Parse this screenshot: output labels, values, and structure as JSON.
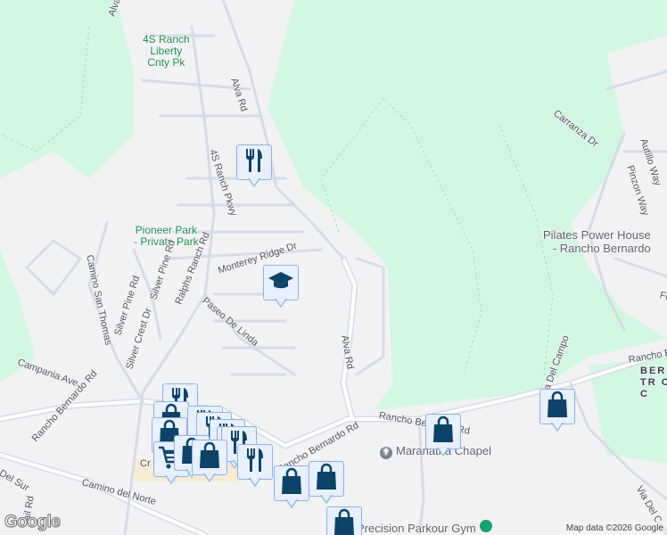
{
  "map": {
    "attribution": "Map data ©2026 Google",
    "logo": "Google",
    "colors": {
      "park": "#d3f6e2",
      "urban": "#f2f1f4",
      "road": "#ffffff",
      "road_edge": "#d5dbe3",
      "marker_bg": "#e8f0fe",
      "marker_icon": "#0d4366"
    },
    "parks": [
      {
        "name": "4S Ranch Liberty Cnty Pk",
        "line1": "4S Ranch",
        "line2": "Liberty",
        "line3": "Cnty Pk"
      },
      {
        "name": "Pioneer Park - Private Park",
        "line1": "Pioneer Park",
        "line2": "- Private Park"
      }
    ],
    "pois": [
      {
        "name": "Pilates Power House - Rancho Bernardo",
        "line1": "Pilates Power House",
        "line2": "- Rancho Bernardo"
      },
      {
        "name": "Maranatha Chapel"
      },
      {
        "name": "Precision Parkour Gym"
      }
    ],
    "streets": [
      "Alva Rd",
      "Alva Rd",
      "Alva Rd",
      "4S Ranch Pkwy",
      "Monterey Ridge Dr",
      "Paseo De Linda",
      "Ralphs Ranch Rd",
      "Silver Pine Rd",
      "Silver Pine Rd",
      "Silver Crest Dr",
      "Camino San Thomas",
      "Campania Ave",
      "Rancho Bernardo Rd",
      "Rancho Bernardo Rd",
      "Rancho Bernardo Rd",
      "Rancho Bernardo Rd",
      "Camino del Norte",
      "Del Sur",
      "Via Del Campo",
      "Via Del Campo",
      "Carranza Dr",
      "Autillo Way",
      "Pinzon Way",
      "Flo",
      "Cr",
      "ail Rd"
    ],
    "area_label": {
      "line1": "BER",
      "line2": "TR C",
      "line3": "C"
    },
    "markers": [
      "restaurant",
      "school",
      "restaurant",
      "shopping",
      "restaurant",
      "restaurant",
      "restaurant",
      "restaurant",
      "shopping",
      "grocery",
      "shopping",
      "restaurant",
      "shopping",
      "shopping",
      "shopping",
      "shopping",
      "shopping",
      "restaurant",
      "shopping"
    ]
  }
}
